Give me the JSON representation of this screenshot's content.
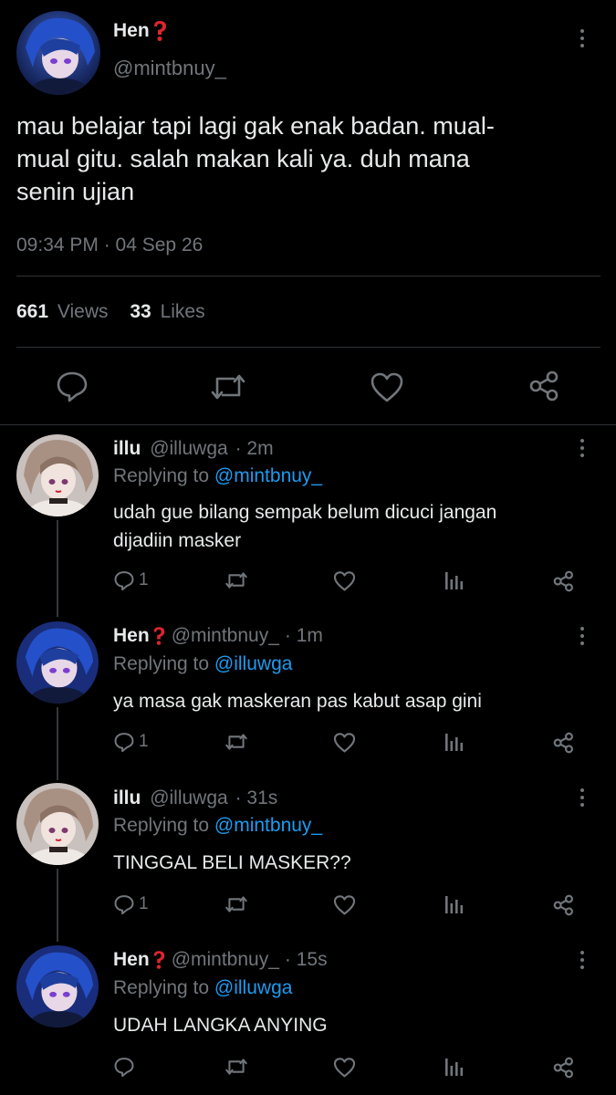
{
  "main_tweet": {
    "display_name": "Hen",
    "handle": "@mintbnuy_",
    "text_lines": [
      "mau belajar tapi lagi gak enak badan. mual-",
      "mual gitu. salah makan kali ya. duh mana",
      "senin ujian"
    ],
    "timestamp": "09:34 PM · 04 Sep 26",
    "views_count": "661",
    "views_label": "Views",
    "likes_count": "33",
    "likes_label": "Likes"
  },
  "replies": [
    {
      "display_name": "illu",
      "handle": "@illuwga",
      "time": "· 2m",
      "replying_prefix": "Replying to",
      "replying_to": "@mintbnuy_",
      "text_lines": [
        "udah gue bilang sempak belum dicuci jangan",
        "dijadiin masker"
      ],
      "reply_count": "1"
    },
    {
      "display_name": "Hen",
      "handle": "@mintbnuy_",
      "time": "· 1m",
      "replying_prefix": "Replying to",
      "replying_to": "@illuwga",
      "text_lines": [
        "ya masa gak maskeran pas kabut asap gini"
      ],
      "reply_count": "1"
    },
    {
      "display_name": "illu",
      "handle": "@illuwga",
      "time": "· 31s",
      "replying_prefix": "Replying to",
      "replying_to": "@mintbnuy_",
      "text_lines": [
        "TINGGAL BELI MASKER??"
      ],
      "reply_count": "1"
    },
    {
      "display_name": "Hen",
      "handle": "@mintbnuy_",
      "time": "· 15s",
      "replying_prefix": "Replying to",
      "replying_to": "@illuwga",
      "text_lines": [
        "UDAH LANGKA ANYING"
      ],
      "reply_count": ""
    }
  ],
  "icons": {
    "badge": "red-question-mark-icon",
    "reply": "speech-bubble-icon",
    "retweet": "retweet-icon",
    "like": "heart-icon",
    "views": "bar-chart-icon",
    "share": "share-icon",
    "more": "vertical-ellipsis-icon"
  },
  "colors": {
    "background": "#000000",
    "text": "#e7e9ea",
    "muted": "#71767b",
    "link": "#1d9bf0",
    "badge": "#e0242e"
  }
}
